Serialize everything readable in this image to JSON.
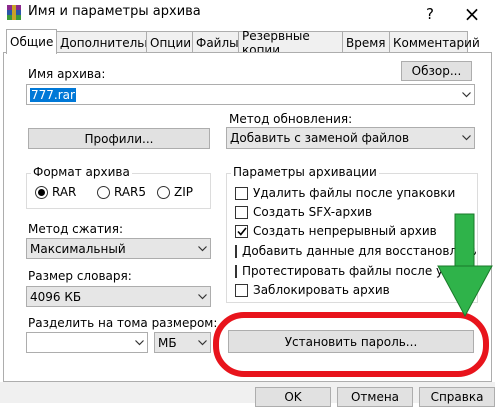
{
  "window": {
    "title": "Имя и параметры архива",
    "help_label": "?",
    "close_label": "×"
  },
  "tabs": [
    {
      "label": "Общие"
    },
    {
      "label": "Дополнительно"
    },
    {
      "label": "Опции"
    },
    {
      "label": "Файлы"
    },
    {
      "label": "Резервные копии"
    },
    {
      "label": "Время"
    },
    {
      "label": "Комментарий"
    }
  ],
  "archive_name": {
    "label": "Имя архива:",
    "value": "777.rar",
    "browse_label": "Обзор..."
  },
  "profiles_label": "Профили...",
  "update_method": {
    "label": "Метод обновления:",
    "value": "Добавить с заменой файлов"
  },
  "format": {
    "title": "Формат архива",
    "options": [
      {
        "label": "RAR",
        "selected": true
      },
      {
        "label": "RAR5",
        "selected": false
      },
      {
        "label": "ZIP",
        "selected": false
      }
    ]
  },
  "compression": {
    "label": "Метод сжатия:",
    "value": "Максимальный"
  },
  "dictionary": {
    "label": "Размер словаря:",
    "value": "4096 КБ"
  },
  "split": {
    "label": "Разделить на тома размером:",
    "value": "",
    "unit": "МБ"
  },
  "params": {
    "title": "Параметры архивации",
    "options": [
      {
        "label": "Удалить файлы после упаковки",
        "checked": false
      },
      {
        "label": "Создать SFX-архив",
        "checked": false
      },
      {
        "label": "Создать непрерывный архив",
        "checked": true
      },
      {
        "label": "Добавить данные для восстановления",
        "checked": false
      },
      {
        "label": "Протестировать файлы после упаковки",
        "checked": false
      },
      {
        "label": "Заблокировать архив",
        "checked": false
      }
    ]
  },
  "set_password_label": "Установить пароль...",
  "footer": {
    "ok": "OK",
    "cancel": "Отмена",
    "help": "Справка"
  },
  "colors": {
    "annotation_red": "#e8141c",
    "annotation_green": "#2fb34a",
    "selection_blue": "#0078d7"
  }
}
